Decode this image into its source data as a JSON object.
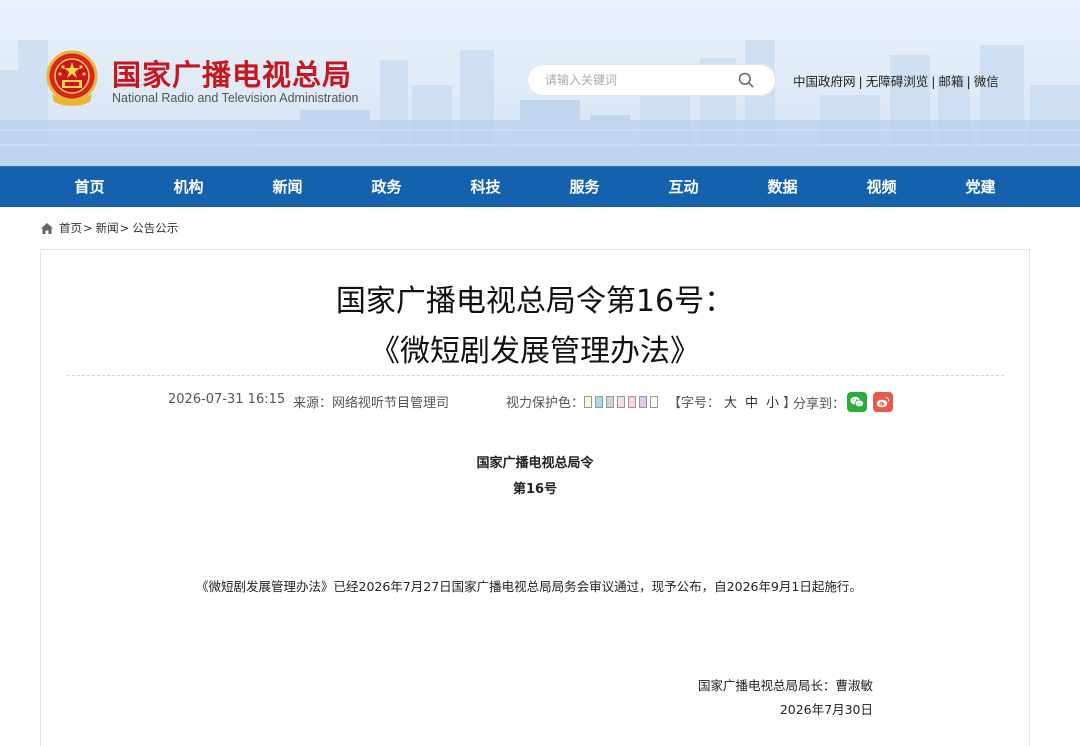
{
  "header": {
    "site_title": "国家广播电视总局",
    "site_subtitle": "National Radio and Television Administration",
    "search_placeholder": "请输入关键词",
    "top_links": [
      "中国政府网",
      "无障碍浏览",
      "邮箱",
      "微信"
    ],
    "separator": "|"
  },
  "nav": {
    "items": [
      "首页",
      "机构",
      "新闻",
      "政务",
      "科技",
      "服务",
      "互动",
      "数据",
      "视频",
      "党建"
    ]
  },
  "breadcrumb": {
    "items": [
      "首页",
      "新闻",
      "公告公示"
    ],
    "separator": ">"
  },
  "article": {
    "title_line1": "国家广播电视总局令第16号：",
    "title_line2": "《微短剧发展管理办法》",
    "date": "2026-07-31 16:15",
    "source": "来源：网络视听节目管理司",
    "vision_label": "视力保护色：",
    "vision_colors": [
      "#fafad2",
      "#add8e6",
      "#d3d3d3",
      "#f0e0e0",
      "#ffd0e8",
      "#e0c8f0",
      "#ffffff"
    ],
    "font_label_open": "【字号：",
    "font_sizes": [
      "大",
      "中",
      "小"
    ],
    "font_label_close": "】",
    "share_label": "分享到：",
    "doc_heading": "国家广播电视总局令",
    "doc_number": "第16号",
    "doc_body": "《微短剧发展管理办法》已经2026年7月27日国家广播电视总局局务会审议通过，现予公布，自2026年9月1日起施行。",
    "doc_signer": "国家广播电视总局局长：曹淑敏",
    "doc_date": "2026年7月30日"
  },
  "colors": {
    "brand_red": "#c8161e",
    "nav_blue": "#1461ad",
    "wechat_green": "#2aae3a",
    "weibo_red": "#e8584b"
  },
  "icons": {
    "emblem": "national-emblem-icon",
    "search": "search-icon",
    "home": "home-icon",
    "wechat": "wechat-icon",
    "weibo": "weibo-icon"
  }
}
